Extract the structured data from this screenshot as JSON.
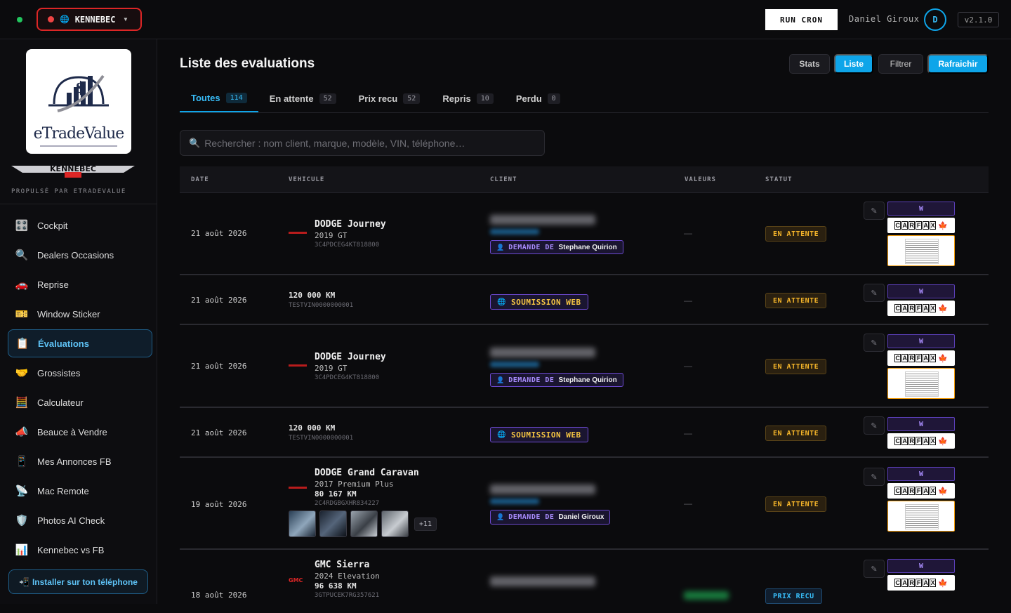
{
  "topbar": {
    "dealer": "KENNEBEC",
    "run_cron": "RUN CRON",
    "user_name": "Daniel Giroux",
    "avatar_initial": "D",
    "version": "v2.1.0"
  },
  "sidebar": {
    "logo_text": "eTradeValue",
    "kennebec_logo": "KENNEBEC",
    "powered_by": "PROPULSÉ PAR ETRADEVALUE",
    "items": [
      {
        "label": "Cockpit",
        "icon": "🎛️"
      },
      {
        "label": "Dealers Occasions",
        "icon": "🔍"
      },
      {
        "label": "Reprise",
        "icon": "🚗"
      },
      {
        "label": "Window Sticker",
        "icon": "🎫"
      },
      {
        "label": "Évaluations",
        "icon": "📋"
      },
      {
        "label": "Grossistes",
        "icon": "🤝"
      },
      {
        "label": "Calculateur",
        "icon": "🧮"
      },
      {
        "label": "Beauce à Vendre",
        "icon": "📣"
      },
      {
        "label": "Mes Annonces FB",
        "icon": "📱"
      },
      {
        "label": "Mac Remote",
        "icon": "📡"
      },
      {
        "label": "Photos AI Check",
        "icon": "🛡️"
      },
      {
        "label": "Kennebec vs FB",
        "icon": "📊"
      }
    ],
    "install": "Installer sur ton téléphone"
  },
  "main": {
    "title": "Liste des evaluations",
    "buttons": {
      "stats": "Stats",
      "liste": "Liste",
      "filtrer": "Filtrer",
      "refresh": "Rafraichir"
    },
    "tabs": [
      {
        "label": "Toutes",
        "count": "114"
      },
      {
        "label": "En attente",
        "count": "52"
      },
      {
        "label": "Prix recu",
        "count": "52"
      },
      {
        "label": "Repris",
        "count": "10"
      },
      {
        "label": "Perdu",
        "count": "0"
      }
    ],
    "search_placeholder": "Rechercher : nom client, marque, modèle, VIN, téléphone…",
    "columns": {
      "date": "DATE",
      "vehicle": "VEHICULE",
      "client": "CLIENT",
      "values": "VALEURS",
      "status": "STATUT"
    },
    "rows": [
      {
        "date": "21 août 2026",
        "title": "DODGE Journey",
        "trim": "2019 GT",
        "vin": "3C4PDCEG4KT818800",
        "request_label": "DEMANDE DE",
        "requester": "Stephane Quirion",
        "value": "—",
        "status": "EN ATTENTE"
      },
      {
        "date": "21 août 2026",
        "km": "120 000 KM",
        "vin": "TESTVIN0000000001",
        "source": "SOUMISSION WEB",
        "value": "—",
        "status": "EN ATTENTE"
      },
      {
        "date": "21 août 2026",
        "title": "DODGE Journey",
        "trim": "2019 GT",
        "vin": "3C4PDCEG4KT818800",
        "request_label": "DEMANDE DE",
        "requester": "Stephane Quirion",
        "value": "—",
        "status": "EN ATTENTE"
      },
      {
        "date": "21 août 2026",
        "km": "120 000 KM",
        "vin": "TESTVIN0000000001",
        "source": "SOUMISSION WEB",
        "value": "—",
        "status": "EN ATTENTE"
      },
      {
        "date": "19 août 2026",
        "title": "DODGE Grand Caravan",
        "trim": "2017 Premium Plus",
        "km": "80 167 KM",
        "vin": "2C4RDGBGXHR834227",
        "request_label": "DEMANDE DE",
        "requester": "Daniel Giroux",
        "value": "—",
        "status": "EN ATTENTE",
        "more_photos": "+11"
      },
      {
        "date": "18 août 2026",
        "title": "GMC Sierra",
        "trim": "2024 Elevation",
        "km": "96 638 KM",
        "vin": "3GTPUCEK7RG357621",
        "status": "PRIX RECU"
      }
    ],
    "actions": {
      "edit_icon": "✎",
      "w_label": "W",
      "carfax_letters": [
        "C",
        "A",
        "R",
        "F",
        "A",
        "X"
      ]
    }
  }
}
